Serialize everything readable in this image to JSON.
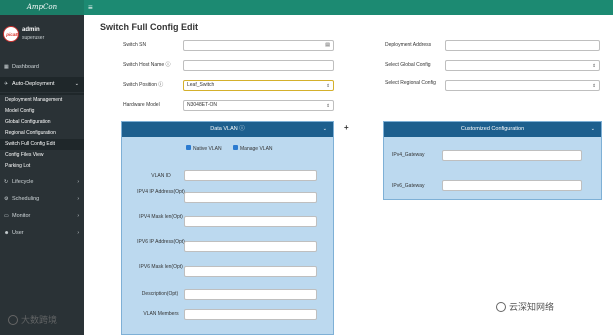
{
  "app": {
    "brand": "AmpCon",
    "menu_icon": "hamburger-icon"
  },
  "profile": {
    "avatar_text": "pica8",
    "name": "admin",
    "role": "superuser"
  },
  "sidebar": {
    "items": [
      {
        "label": "Dashboard",
        "icon": "dashboard-icon"
      },
      {
        "label": "Auto-Deployment",
        "icon": "rocket-icon",
        "chevron": "⌄"
      },
      {
        "label": "Lifecycle",
        "icon": "refresh-icon",
        "chevron": "›"
      },
      {
        "label": "Scheduling",
        "icon": "gear-icon",
        "chevron": "›"
      },
      {
        "label": "Monitor",
        "icon": "monitor-icon",
        "chevron": "›"
      },
      {
        "label": "User",
        "icon": "users-icon",
        "chevron": "›"
      }
    ],
    "subitems": [
      {
        "label": "Deployment Management"
      },
      {
        "label": "Model Config"
      },
      {
        "label": "Global Configuration"
      },
      {
        "label": "Regional Configuration"
      },
      {
        "label": "Switch Full Config Edit"
      },
      {
        "label": "Config Files View"
      },
      {
        "label": "Parking Lot"
      }
    ]
  },
  "page": {
    "title": "Switch Full Config Edit"
  },
  "form_left": {
    "switch_sn": {
      "label": "Switch SN",
      "value": ""
    },
    "host_name": {
      "label": "Switch Host Name ⓘ",
      "value": ""
    },
    "position": {
      "label": "Switch Position ⓘ",
      "value": "Leaf_Switch"
    },
    "hardware_model": {
      "label": "Hardware Model",
      "value": "N3048ET-ON"
    }
  },
  "form_right": {
    "deployment_address": {
      "label": "Deployment Address",
      "value": ""
    },
    "global_config": {
      "label": "Select Global Config",
      "value": ""
    },
    "regional_config": {
      "label": "Select Regional Config",
      "value": ""
    }
  },
  "vlan_panel": {
    "title": "Data VLAN ⓘ",
    "native_vlan": "Native VLAN",
    "manage_vlan": "Manage VLAN",
    "fields": [
      {
        "label": "VLAN ID",
        "value": ""
      },
      {
        "label": "IPV4 IP Address(Opt)",
        "value": ""
      },
      {
        "label": "IPV4 Mask len(Opt)",
        "value": ""
      },
      {
        "label": "IPV6 IP Address(Opt)",
        "value": ""
      },
      {
        "label": "IPV6 Mask len(Opt)",
        "value": ""
      },
      {
        "label": "Description(Opt)",
        "value": ""
      },
      {
        "label": "VLAN Members",
        "value": ""
      }
    ]
  },
  "custom_panel": {
    "title": "Customized Configuration",
    "fields": [
      {
        "label": "IPv4_Gateway",
        "value": ""
      },
      {
        "label": "IPv6_Gateway",
        "value": ""
      }
    ]
  },
  "add_symbol": "+",
  "watermarks": {
    "left": "大数跨境",
    "right": "云深知网络"
  },
  "colors": {
    "topbar": "#1c8a72",
    "sidebar": "#2a3236",
    "panel_header": "#1d5f8e",
    "panel_body": "#bcd9ef"
  }
}
